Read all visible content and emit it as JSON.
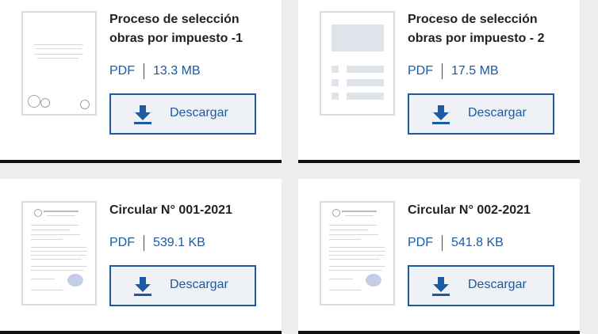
{
  "documents": [
    {
      "title": "Proceso de selección obras por impuesto -1",
      "type": "PDF",
      "size": "13.3 MB",
      "button": "Descargar",
      "thumbnail": "scanned-document"
    },
    {
      "title": "Proceso de selección obras por impuesto - 2",
      "type": "PDF",
      "size": "17.5 MB",
      "button": "Descargar",
      "thumbnail": "generic-document-icon"
    },
    {
      "title": "Circular N° 001-2021",
      "type": "PDF",
      "size": "539.1 KB",
      "button": "Descargar",
      "thumbnail": "scanned-letter"
    },
    {
      "title": "Circular N° 002-2021",
      "type": "PDF",
      "size": "541.8 KB",
      "button": "Descargar",
      "thumbnail": "scanned-letter"
    }
  ],
  "colors": {
    "accent": "#1e5aa0",
    "button_bg": "#eef1f6",
    "card_bottom_bar": "#111111",
    "page_bg": "#ededed"
  },
  "icons": {
    "download": "download-icon"
  }
}
